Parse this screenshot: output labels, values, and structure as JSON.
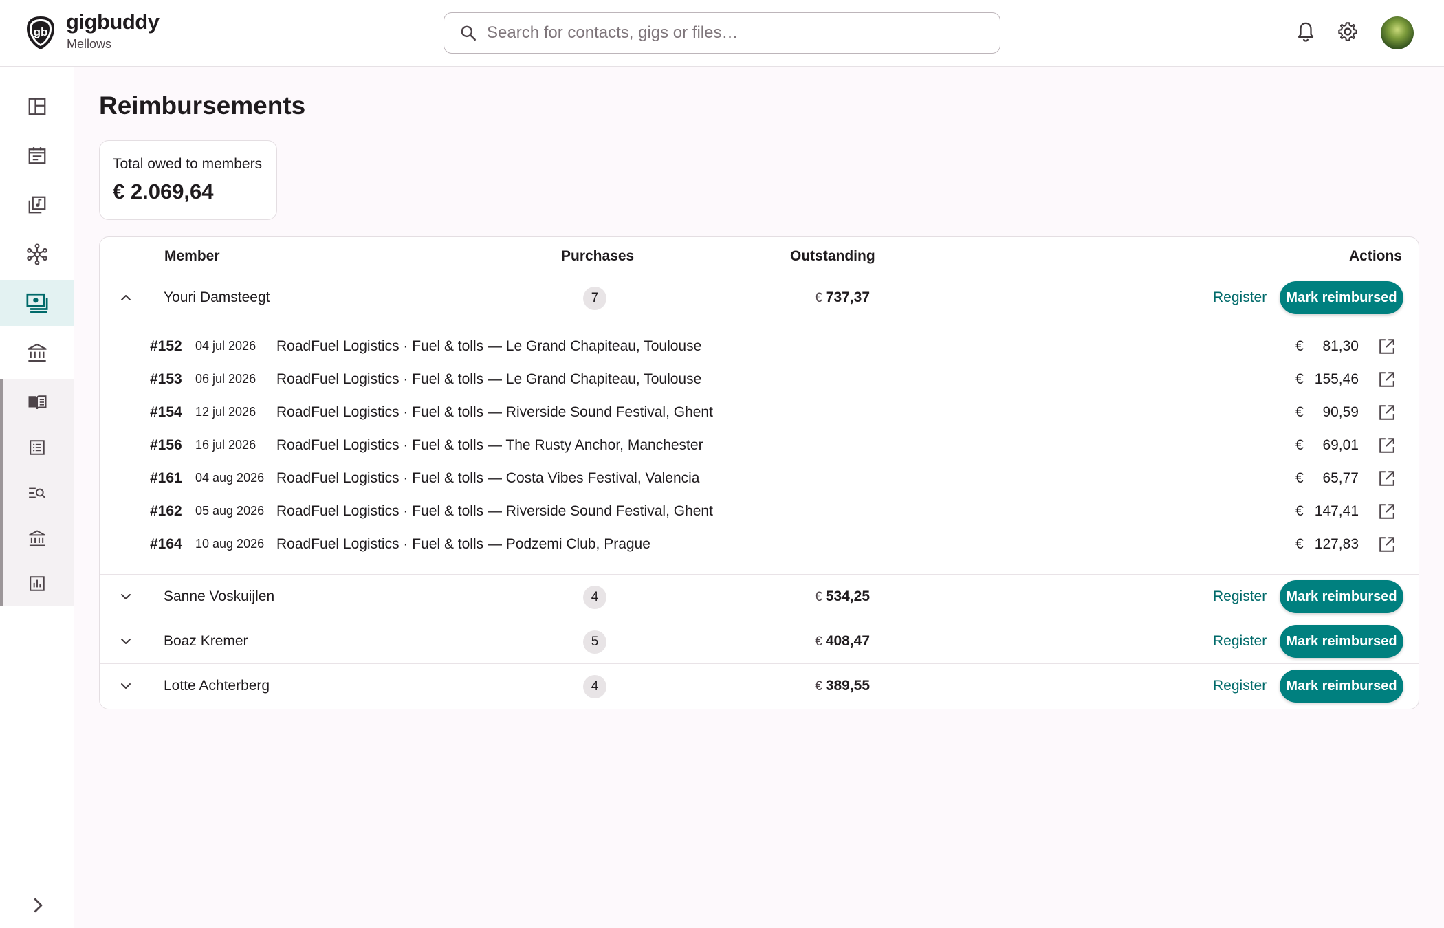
{
  "app": {
    "brand": "gigbuddy",
    "org": "Mellows",
    "logo_text": "gb"
  },
  "search": {
    "placeholder": "Search for contacts, gigs or files…"
  },
  "header_icons": [
    "bell-icon",
    "gear-icon",
    "avatar"
  ],
  "rail": {
    "items": [
      "dashboard-icon",
      "calendar-icon",
      "music-library-icon",
      "network-icon",
      "reimbursements-icon",
      "bank-icon"
    ],
    "sub_items": [
      "ledger-book-icon",
      "list-icon",
      "search-list-icon",
      "bank-icon",
      "bar-chart-icon"
    ],
    "active": "reimbursements-icon"
  },
  "page": {
    "title": "Reimbursements"
  },
  "summary": {
    "label": "Total owed to members",
    "value": "€ 2.069,64"
  },
  "table": {
    "headers": {
      "member": "Member",
      "purchases": "Purchases",
      "outstanding": "Outstanding",
      "actions": "Actions"
    },
    "register_label": "Register",
    "mark_label": "Mark reimbursed",
    "currency": "€",
    "members": [
      {
        "name": "Youri Damsteegt",
        "count": "7",
        "outstanding": "737,37",
        "expanded": true,
        "purchases": [
          {
            "id": "#152",
            "date": "04 jul 2026",
            "desc": "RoadFuel Logistics · Fuel & tolls — Le Grand Chapiteau, Toulouse",
            "amount": "81,30"
          },
          {
            "id": "#153",
            "date": "06 jul 2026",
            "desc": "RoadFuel Logistics · Fuel & tolls — Le Grand Chapiteau, Toulouse",
            "amount": "155,46"
          },
          {
            "id": "#154",
            "date": "12 jul 2026",
            "desc": "RoadFuel Logistics · Fuel & tolls — Riverside Sound Festival, Ghent",
            "amount": "90,59"
          },
          {
            "id": "#156",
            "date": "16 jul 2026",
            "desc": "RoadFuel Logistics · Fuel & tolls — The Rusty Anchor, Manchester",
            "amount": "69,01"
          },
          {
            "id": "#161",
            "date": "04 aug 2026",
            "desc": "RoadFuel Logistics · Fuel & tolls — Costa Vibes Festival, Valencia",
            "amount": "65,77"
          },
          {
            "id": "#162",
            "date": "05 aug 2026",
            "desc": "RoadFuel Logistics · Fuel & tolls — Riverside Sound Festival, Ghent",
            "amount": "147,41"
          },
          {
            "id": "#164",
            "date": "10 aug 2026",
            "desc": "RoadFuel Logistics · Fuel & tolls — Podzemi Club, Prague",
            "amount": "127,83"
          }
        ]
      },
      {
        "name": "Sanne Voskuijlen",
        "count": "4",
        "outstanding": "534,25",
        "expanded": false
      },
      {
        "name": "Boaz Kremer",
        "count": "5",
        "outstanding": "408,47",
        "expanded": false
      },
      {
        "name": "Lotte Achterberg",
        "count": "4",
        "outstanding": "389,55",
        "expanded": false
      }
    ]
  },
  "colors": {
    "accent": "#00807f",
    "link": "#006a6a",
    "active_rail": "#e3f2f2",
    "background": "#fdf9fc"
  }
}
